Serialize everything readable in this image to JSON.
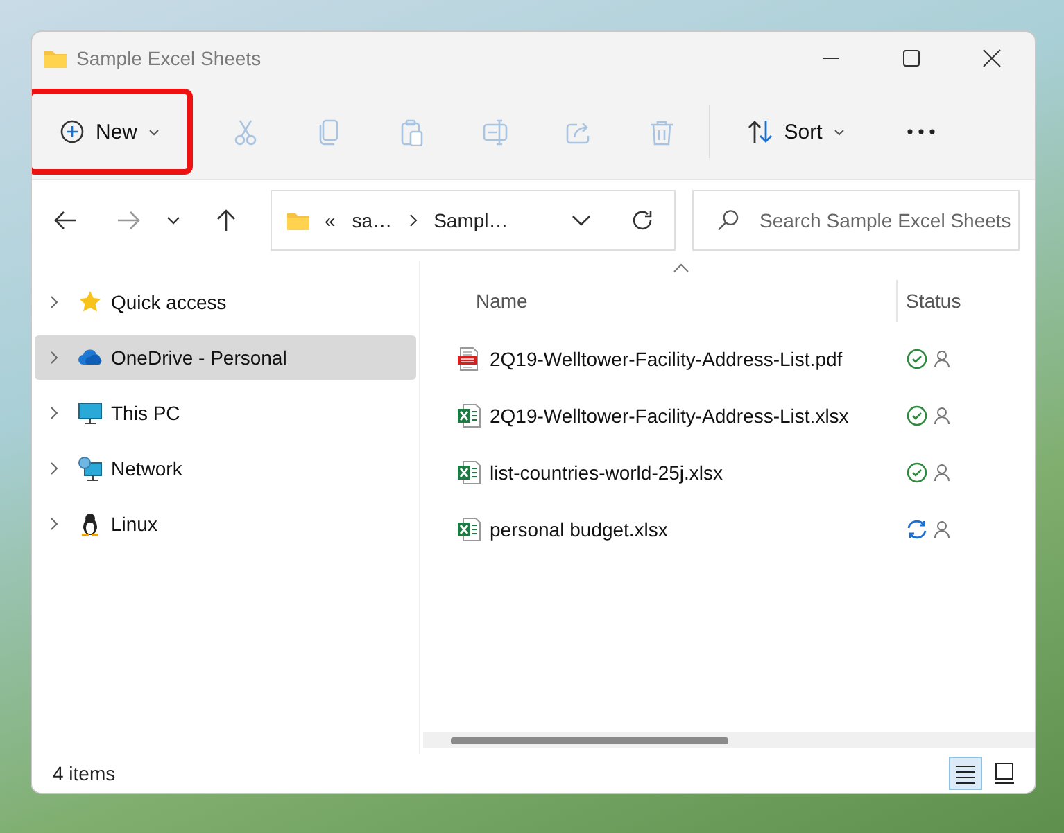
{
  "window": {
    "title": "Sample Excel Sheets"
  },
  "toolbar": [
    {
      "kind": "new",
      "label": "New",
      "disabled": false,
      "highlighted": true
    },
    {
      "kind": "cut",
      "disabled": true
    },
    {
      "kind": "copy",
      "disabled": true
    },
    {
      "kind": "paste",
      "disabled": true
    },
    {
      "kind": "rename",
      "disabled": true
    },
    {
      "kind": "share",
      "disabled": true
    },
    {
      "kind": "delete",
      "disabled": true
    },
    {
      "kind": "sort",
      "label": "Sort",
      "disabled": false,
      "highlighted": false
    },
    {
      "kind": "more",
      "disabled": false
    }
  ],
  "address": {
    "overflow": "«",
    "crumbs": [
      "sa…",
      "Sampl…"
    ]
  },
  "search": {
    "placeholder": "Search Sample Excel Sheets"
  },
  "sidebar": {
    "items": [
      {
        "label": "Quick access",
        "kind": "star",
        "selected": false
      },
      {
        "label": "OneDrive - Personal",
        "kind": "cloud",
        "selected": true
      },
      {
        "label": "This PC",
        "kind": "pc",
        "selected": false
      },
      {
        "label": "Network",
        "kind": "network",
        "selected": false
      },
      {
        "label": "Linux",
        "kind": "penguin",
        "selected": false
      }
    ]
  },
  "table": {
    "columns": [
      "Name",
      "Status"
    ],
    "rows": [
      {
        "name": "2Q19-Welltower-Facility-Address-List.pdf",
        "kind": "pdf",
        "status": {
          "kind": "synced"
        }
      },
      {
        "name": "2Q19-Welltower-Facility-Address-List.xlsx",
        "kind": "excel",
        "status": {
          "kind": "synced"
        }
      },
      {
        "name": "list-countries-world-25j.xlsx",
        "kind": "excel",
        "status": {
          "kind": "synced"
        }
      },
      {
        "name": "personal budget.xlsx",
        "kind": "excel",
        "status": {
          "kind": "syncing"
        }
      }
    ]
  },
  "status_bar": {
    "count": "4 items",
    "views": [
      {
        "kind": "details",
        "selected": true
      },
      {
        "kind": "tiles",
        "selected": false
      }
    ]
  }
}
